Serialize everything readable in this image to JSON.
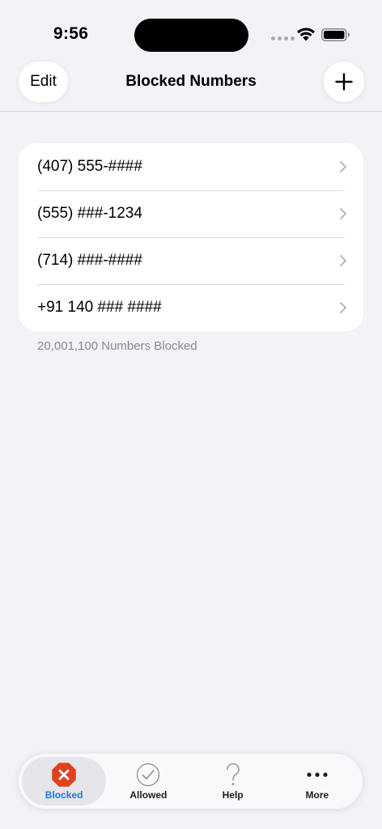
{
  "status_bar": {
    "time": "9:56",
    "icons": [
      "signal-dots-icon",
      "wifi-icon",
      "battery-icon"
    ]
  },
  "nav": {
    "edit_label": "Edit",
    "title": "Blocked Numbers",
    "add_icon": "plus-icon"
  },
  "blocked": {
    "items": [
      {
        "label": "(407) 555-####"
      },
      {
        "label": "(555) ###-1234"
      },
      {
        "label": "(714) ###-####"
      },
      {
        "label": "+91 140 ### ####"
      }
    ],
    "footer": "20,001,100 Numbers Blocked"
  },
  "tabs": [
    {
      "label": "Blocked",
      "icon": "x-octagon-icon",
      "active": true
    },
    {
      "label": "Allowed",
      "icon": "checkmark-circle-icon",
      "active": false
    },
    {
      "label": "Help",
      "icon": "question-mark-icon",
      "active": false
    },
    {
      "label": "More",
      "icon": "ellipsis-icon",
      "active": false
    }
  ],
  "colors": {
    "background": "#f2f2f7",
    "accent": "#2477d9",
    "blocked_red": "#e1401f",
    "secondary_text": "#8a8a8e"
  }
}
